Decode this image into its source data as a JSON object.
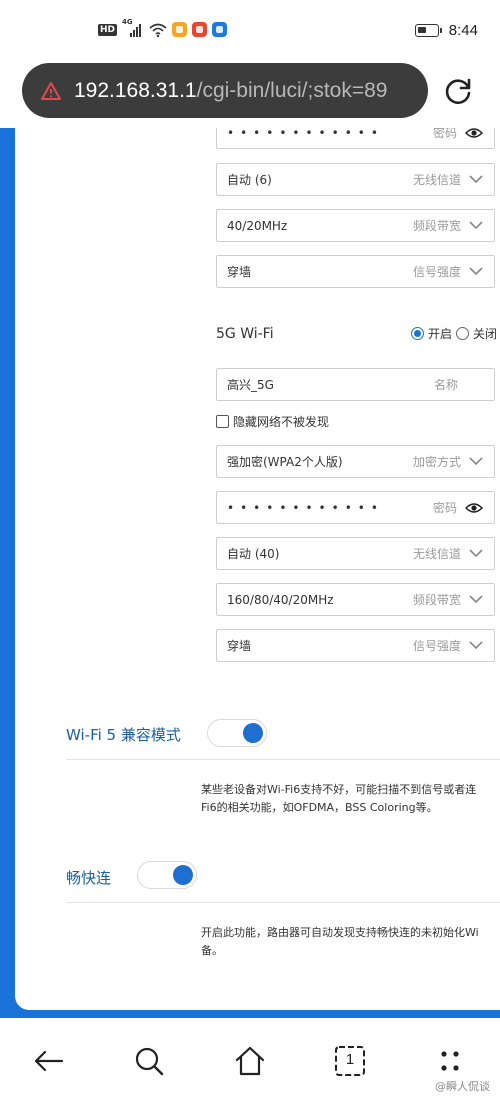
{
  "status_bar": {
    "hd": "HD",
    "network": "4G",
    "time": "8:44",
    "app_colors": [
      "#f5a623",
      "#e8452f",
      "#1f7ae0"
    ]
  },
  "url_bar": {
    "host": "192.168.31.1",
    "path": "/cgi-bin/luci/;stok=89"
  },
  "wifi24_partial": {
    "password_dots": "••••••••••••",
    "password_label": "密码",
    "channel_value": "自动 (6)",
    "channel_label": "无线信道",
    "bandwidth_value": "40/20MHz",
    "bandwidth_label": "频段带宽",
    "signal_value": "穿墙",
    "signal_label": "信号强度"
  },
  "wifi5g": {
    "title": "5G Wi-Fi",
    "on_label": "开启",
    "off_label": "关闭",
    "name_value": "高兴_5G",
    "name_label": "名称",
    "hide_network_label": "隐藏网络不被发现",
    "encryption_value": "强加密(WPA2个人版)",
    "encryption_label": "加密方式",
    "password_dots": "••••••••••••",
    "password_label": "密码",
    "channel_value": "自动 (40)",
    "channel_label": "无线信道",
    "bandwidth_value": "160/80/40/20MHz",
    "bandwidth_label": "频段带宽",
    "signal_value": "穿墙",
    "signal_label": "信号强度"
  },
  "wifi5_compat": {
    "label": "Wi-Fi 5 兼容模式",
    "enabled": true,
    "desc_line1": "某些老设备对Wi-Fi6支持不好，可能扫描不到信号或者连",
    "desc_line2": "Fi6的相关功能，如OFDMA，BSS Coloring等。"
  },
  "quick_connect": {
    "label": "畅快连",
    "enabled": true,
    "desc_line1": "开启此功能，路由器可自动发现支持畅快连的未初始化Wi",
    "desc_line2": "备。"
  },
  "bottom_nav": {
    "tab_count": "1",
    "watermark": "@瞬人侃谈"
  },
  "colors": {
    "accent": "#1a73d8",
    "toggle_on": "#1f6fd0",
    "label_blue": "#1a5fa8"
  }
}
